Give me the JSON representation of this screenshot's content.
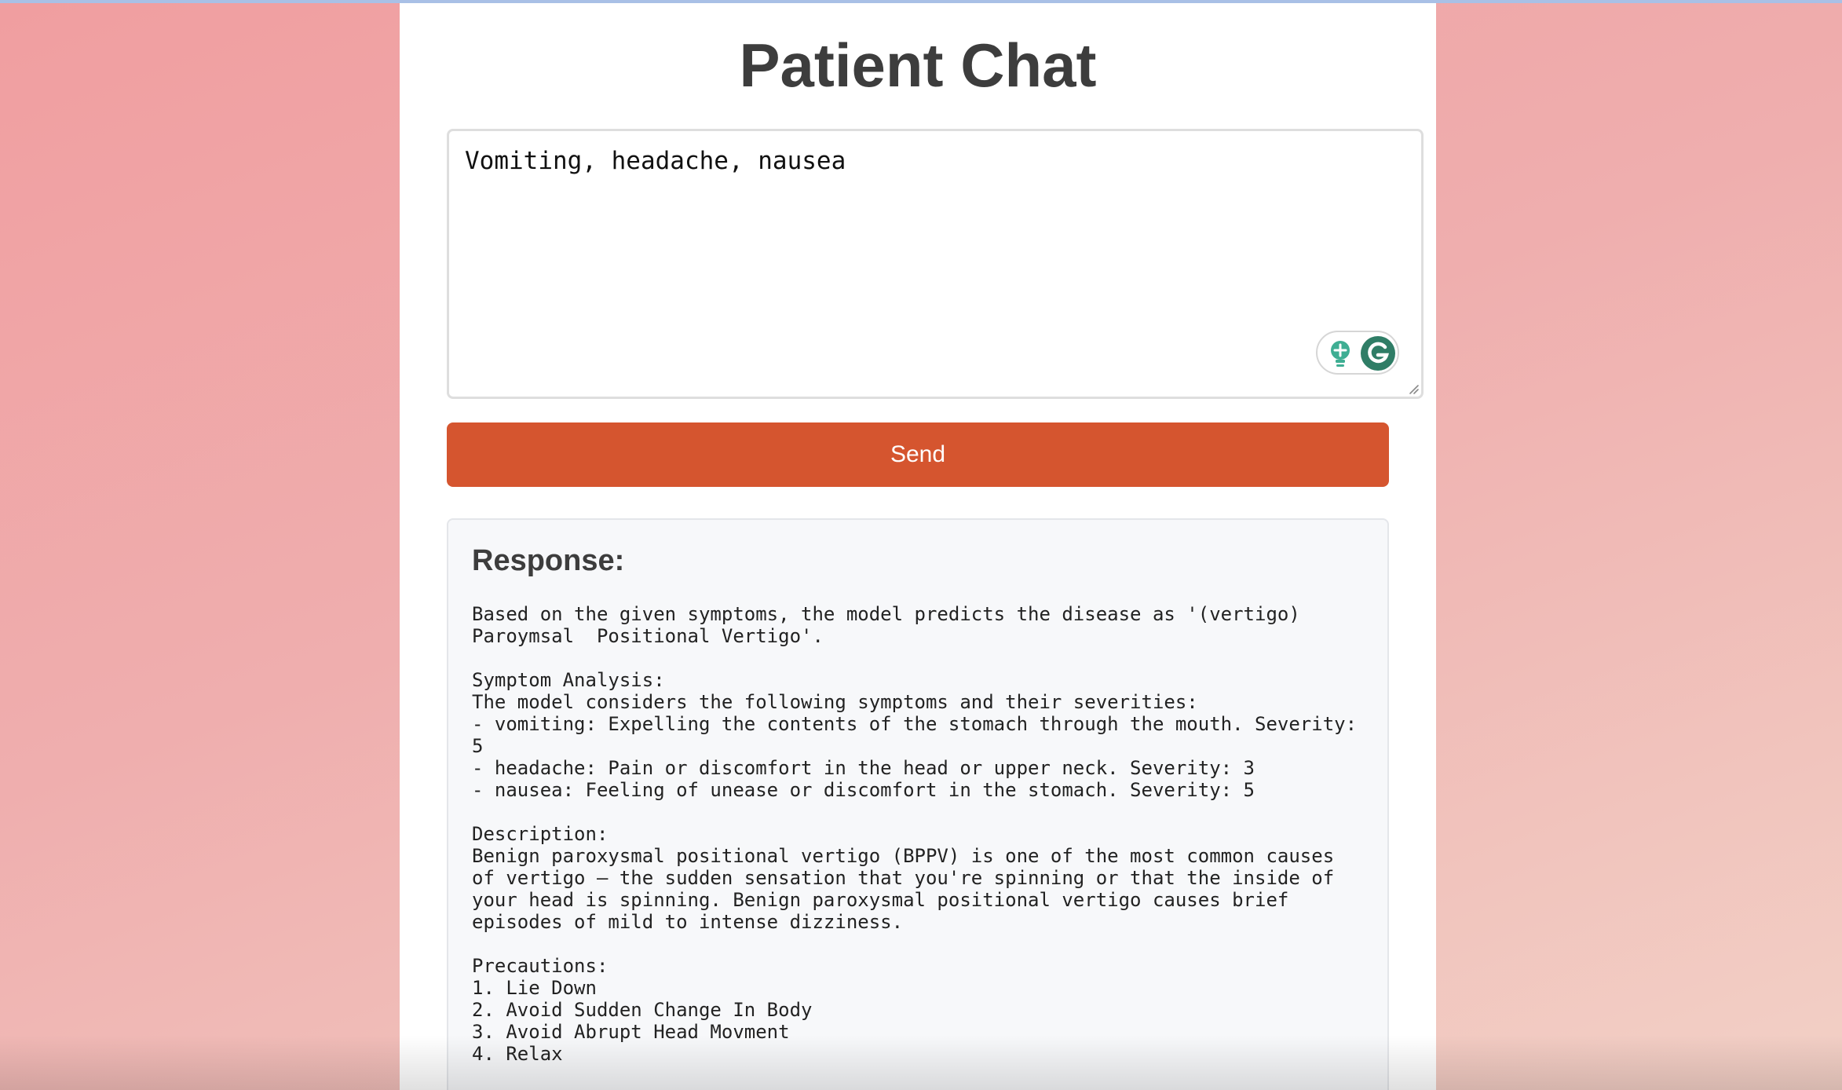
{
  "colors": {
    "background_start": "#f09ea0",
    "background_end": "#f2d0c6",
    "panel": "#ffffff",
    "send_button": "#d5552f",
    "response_box": "#f7f8fa",
    "title_text": "#3d3d3d"
  },
  "header": {
    "title": "Patient Chat"
  },
  "input": {
    "value": "Vomiting, headache, nausea",
    "assist_icons": [
      "bulb-icon",
      "grammar-g-icon"
    ]
  },
  "send_label": "Send",
  "response": {
    "heading": "Response:",
    "lines": [
      "Based on the given symptoms, the model predicts the disease as '(vertigo)",
      "Paroymsal  Positional Vertigo'.",
      "",
      "Symptom Analysis:",
      "The model considers the following symptoms and their severities:",
      "- vomiting: Expelling the contents of the stomach through the mouth. Severity:",
      "5",
      "- headache: Pain or discomfort in the head or upper neck. Severity: 3",
      "- nausea: Feeling of unease or discomfort in the stomach. Severity: 5",
      "",
      "Description:",
      "Benign paroxysmal positional vertigo (BPPV) is one of the most common causes",
      "of vertigo — the sudden sensation that you're spinning or that the inside of",
      "your head is spinning. Benign paroxysmal positional vertigo causes brief",
      "episodes of mild to intense dizziness.",
      "",
      "Precautions:",
      "1. Lie Down",
      "2. Avoid Sudden Change In Body",
      "3. Avoid Abrupt Head Movment",
      "4. Relax"
    ]
  }
}
